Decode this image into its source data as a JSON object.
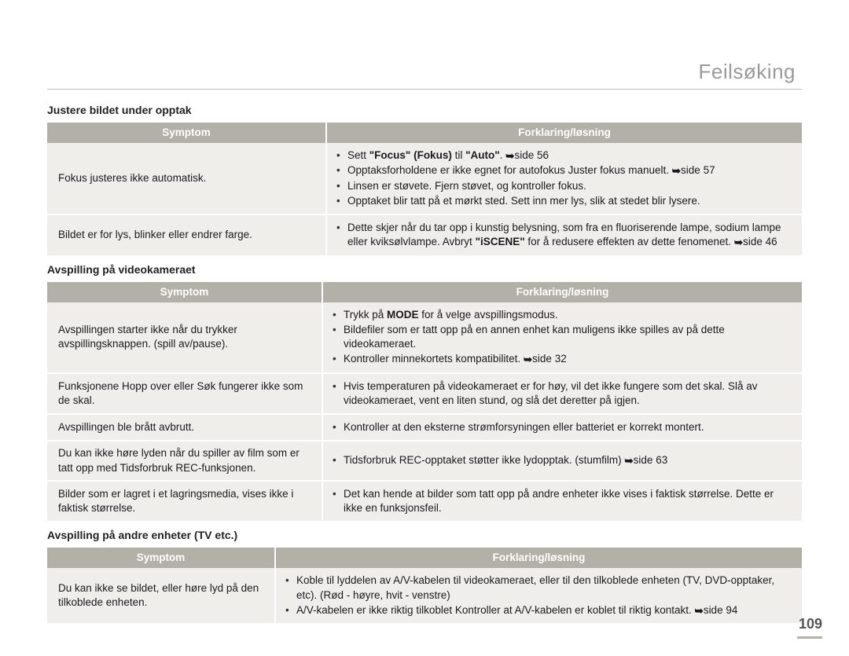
{
  "header": {
    "title": "Feilsøking"
  },
  "page_number": "109",
  "arrow_glyph": "➥",
  "columns": {
    "symptom": "Symptom",
    "solution": "Forklaring/løsning"
  },
  "sections": [
    {
      "title": "Justere bildet under opptak",
      "rows": [
        {
          "symptom": "Fokus justeres ikke automatisk.",
          "bullets": [
            {
              "pre": "Sett ",
              "bold": "\"Focus\" (Fokus)",
              "mid": " til ",
              "bold2": "\"Auto\"",
              "post": ". ",
              "arrow": true,
              "ref": "side 56"
            },
            {
              "text": "Opptaksforholdene er ikke egnet for autofokus Juster fokus manuelt. ",
              "arrow": true,
              "ref": "side 57"
            },
            {
              "text": "Linsen er støvete. Fjern støvet, og kontroller fokus."
            },
            {
              "text": "Opptaket blir tatt på et mørkt sted. Sett inn mer lys, slik at stedet blir lysere."
            }
          ]
        },
        {
          "symptom": "Bildet er for lys, blinker eller endrer farge.",
          "bullets": [
            {
              "text": "Dette skjer når du tar opp i kunstig belysning, som fra en fluoriserende lampe, sodium lampe eller kviksølvlampe.  Avbryt ",
              "bold": "\"iSCENE\"",
              "post": " for å redusere effekten av dette fenomenet. ",
              "arrow": true,
              "ref": "side 46"
            }
          ]
        }
      ]
    },
    {
      "title": "Avspilling på videokameraet",
      "rows": [
        {
          "symptom": "Avspillingen starter ikke når du trykker avspillingsknappen. (spill av/pause).",
          "bullets": [
            {
              "text": "Trykk på ",
              "bold": "MODE",
              "post": " for å velge avspillingsmodus."
            },
            {
              "text": "Bildefiler som er tatt opp på en annen enhet kan muligens ikke spilles av på dette videokameraet."
            },
            {
              "text": "Kontroller minnekortets kompatibilitet. ",
              "arrow": true,
              "ref": "side 32"
            }
          ]
        },
        {
          "symptom": "Funksjonene Hopp over eller Søk fungerer ikke som de skal.",
          "bullets": [
            {
              "text": "Hvis temperaturen på videokameraet er for høy, vil det ikke fungere som det skal. Slå av videokameraet, vent en liten stund, og slå det deretter på igjen."
            }
          ]
        },
        {
          "symptom": "Avspillingen ble brått avbrutt.",
          "bullets": [
            {
              "text": "Kontroller at den eksterne strømforsyningen eller batteriet er korrekt montert."
            }
          ]
        },
        {
          "symptom": "Du kan ikke høre lyden når du spiller av film som er tatt opp med Tidsforbruk REC-funksjonen.",
          "bullets": [
            {
              "text": "Tidsforbruk REC-opptaket støtter ikke lydopptak. (stumfilm) ",
              "arrow": true,
              "ref": "side 63"
            }
          ]
        },
        {
          "symptom": "Bilder som er lagret i et lagringsmedia, vises ikke i faktisk størrelse.",
          "bullets": [
            {
              "text": "Det kan hende at bilder som tatt opp på andre enheter ikke vises i faktisk størrelse. Dette er ikke en funksjonsfeil."
            }
          ]
        }
      ]
    },
    {
      "title": "Avspilling på andre enheter (TV etc.)",
      "rows": [
        {
          "symptom": "Du kan ikke se bildet, eller høre lyd på den tilkoblede enheten.",
          "bullets": [
            {
              "text": "Koble til lyddelen av A/V-kabelen til videokameraet, eller til den tilkoblede enheten (TV, DVD-opptaker, etc). (Rød - høyre, hvit - venstre)"
            },
            {
              "text": "A/V-kabelen er ikke riktig tilkoblet Kontroller at A/V-kabelen er koblet til riktig kontakt. ",
              "arrow": true,
              "ref": "side 94"
            }
          ]
        }
      ]
    }
  ]
}
